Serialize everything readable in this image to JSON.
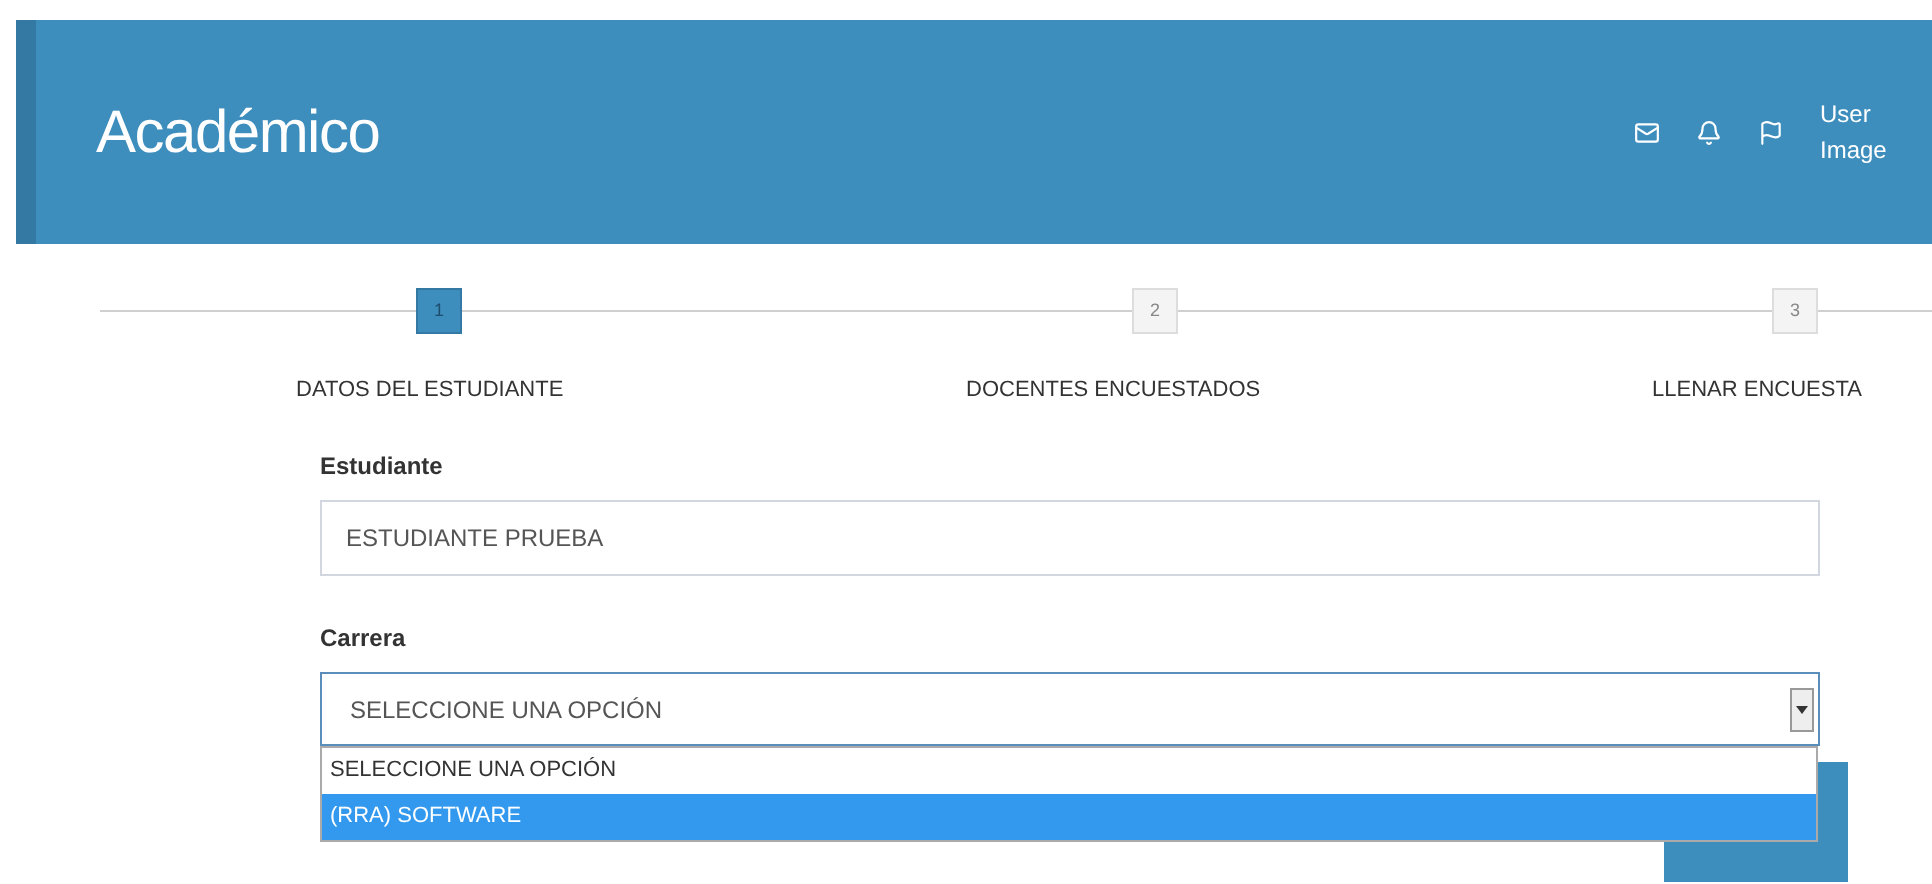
{
  "header": {
    "title": "Académico",
    "user": "User Image"
  },
  "steps": [
    {
      "number": "1",
      "label": "DATOS DEL ESTUDIANTE",
      "selected": true
    },
    {
      "number": "2",
      "label": "DOCENTES ENCUESTADOS",
      "selected": false
    },
    {
      "number": "3",
      "label": "LLENAR ENCUESTA",
      "selected": false
    }
  ],
  "form": {
    "student_label": "Estudiante",
    "student_value": "ESTUDIANTE PRUEBA",
    "career_label": "Carrera",
    "career_value": "SELECCIONE UNA OPCIÓN",
    "career_options": [
      {
        "label": "SELECCIONE UNA OPCIÓN",
        "selected": false
      },
      {
        "label": "(RRA) SOFTWARE",
        "selected": true
      }
    ]
  }
}
